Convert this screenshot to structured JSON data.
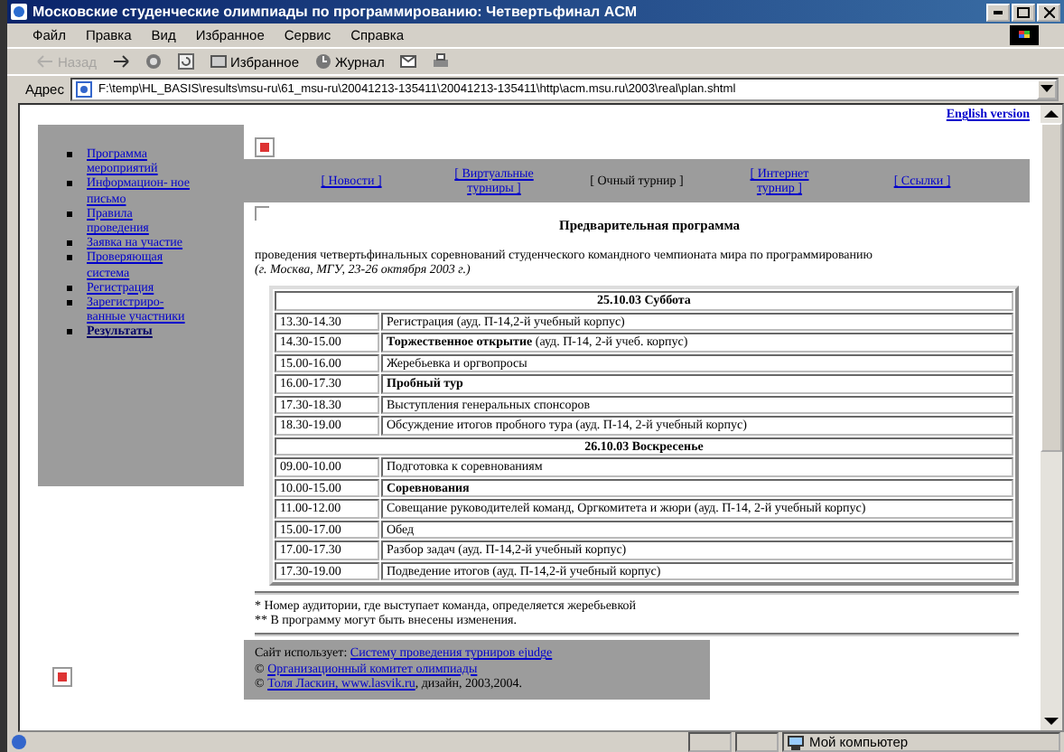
{
  "window": {
    "title": "Московские студенческие олимпиады по программированию: Четвертьфинал ACM"
  },
  "menu": [
    "Файл",
    "Правка",
    "Вид",
    "Избранное",
    "Сервис",
    "Справка"
  ],
  "toolbar": [
    {
      "kind": "back",
      "label": "Назад",
      "disabled": true
    },
    {
      "kind": "forward",
      "disabled": false
    },
    {
      "kind": "stop",
      "disabled": false
    },
    {
      "kind": "refresh",
      "disabled": false
    },
    {
      "kind": "favorites",
      "label": "Избранное",
      "disabled": false
    },
    {
      "kind": "history",
      "label": "Журнал",
      "disabled": false
    },
    {
      "kind": "mail",
      "disabled": false
    },
    {
      "kind": "print",
      "disabled": false
    }
  ],
  "address": {
    "label": "Адрес",
    "value": "F:\\temp\\HL_BASIS\\results\\msu-ru\\61_msu-ru\\20041213-135411\\20041213-135411\\http\\acm.msu.ru\\2003\\real\\plan.shtml"
  },
  "page": {
    "english_link": "English version",
    "sidebar": [
      {
        "label": "Программа мероприятий",
        "selected": false
      },
      {
        "label": "Информацион- ное письмо",
        "selected": false
      },
      {
        "label": "Правила проведения",
        "selected": false
      },
      {
        "label": "Заявка на участие",
        "selected": false
      },
      {
        "label": "Проверяющая система",
        "selected": false
      },
      {
        "label": "Регистрация",
        "selected": false
      },
      {
        "label": "Зарегистриро- ванные участники",
        "selected": false
      },
      {
        "label": "Результаты",
        "selected": true
      }
    ],
    "nav": [
      {
        "label": "[ Новости ]",
        "selected": false
      },
      {
        "label": "[ Виртуальные турниры ]",
        "selected": false
      },
      {
        "label": "[ Очный турнир ]",
        "selected": true
      },
      {
        "label": "[ Интернет турнир ]",
        "selected": false
      },
      {
        "label": "[ Ссылки ]",
        "selected": false
      }
    ],
    "heading": "Предварительная программа",
    "intro": "проведения четвертьфинальных соревнований студенческого командного чемпионата мира по программированию",
    "place": "(г. Москва, МГУ, 23-26 октября 2003 г.)",
    "schedule": [
      {
        "day": "25.10.03 Суббота",
        "rows": [
          {
            "time": "13.30-14.30",
            "event": "Регистрация (ауд. П-14,2-й учебный корпус)"
          },
          {
            "time": "14.30-15.00",
            "event": "**Торжественное открытие** (ауд. П-14, 2-й учеб. корпус)"
          },
          {
            "time": "15.00-16.00",
            "event": "Жеребьевка и оргвопросы"
          },
          {
            "time": "16.00-17.30",
            "event": "**Пробный тур**"
          },
          {
            "time": "17.30-18.30",
            "event": "Выступления генеральных спонсоров"
          },
          {
            "time": "18.30-19.00",
            "event": "Обсуждение итогов пробного тура (ауд. П-14, 2-й учебный корпус)"
          }
        ]
      },
      {
        "day": "26.10.03 Воскресенье",
        "rows": [
          {
            "time": "09.00-10.00",
            "event": "Подготовка к соревнованиям"
          },
          {
            "time": "10.00-15.00",
            "event": "**Соревнования**"
          },
          {
            "time": "11.00-12.00",
            "event": "Совещание руководителей команд, Оргкомитета и жюри (ауд. П-14, 2-й учебный корпус)"
          },
          {
            "time": "15.00-17.00",
            "event": "Обед"
          },
          {
            "time": "17.00-17.30",
            "event": "Разбор задач (ауд. П-14,2-й учебный корпус)"
          },
          {
            "time": "17.30-19.00",
            "event": "Подведение итогов (ауд. П-14,2-й учебный корпус)"
          }
        ]
      }
    ],
    "footnotes": [
      "* Номер аудитории, где выступает команда, определяется жеребьевкой",
      "** В программу могут быть внесены изменения."
    ],
    "footer": [
      {
        "text": "Сайт использует: ",
        "link": "Систему проведения турниров ejudge"
      },
      {
        "text": "© ",
        "link": "Организационный комитет олимпиады"
      },
      {
        "text": "© ",
        "link": "Толя Ласкин, www.lasvik.ru",
        "after": ", дизайн, 2003,2004."
      }
    ]
  },
  "status_bar": {
    "zone": "Мой компьютер"
  }
}
